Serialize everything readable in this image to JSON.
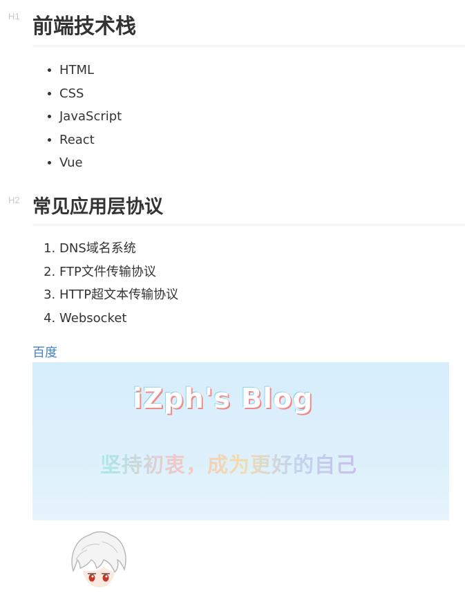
{
  "headings": [
    {
      "level_marker": "H1",
      "text": "前端技术栈"
    },
    {
      "level_marker": "H2",
      "text": "常见应用层协议"
    }
  ],
  "tech_stack": [
    "HTML",
    "CSS",
    "JavaScript",
    "React",
    "Vue"
  ],
  "protocols": [
    "DNS域名系统",
    "FTP文件传输协议",
    "HTTP超文本传输协议",
    "Websocket"
  ],
  "link": {
    "text": "百度"
  },
  "banner": {
    "title": "iZph's Blog",
    "slogan": "坚持初衷，成为更好的自己"
  },
  "colors": {
    "text": "#333333",
    "link": "#4183c4",
    "heading_marker": "#c8c8c8",
    "banner_bg": "#dcf0fb"
  },
  "icons": {
    "avatar": "anime-avatar-image"
  }
}
